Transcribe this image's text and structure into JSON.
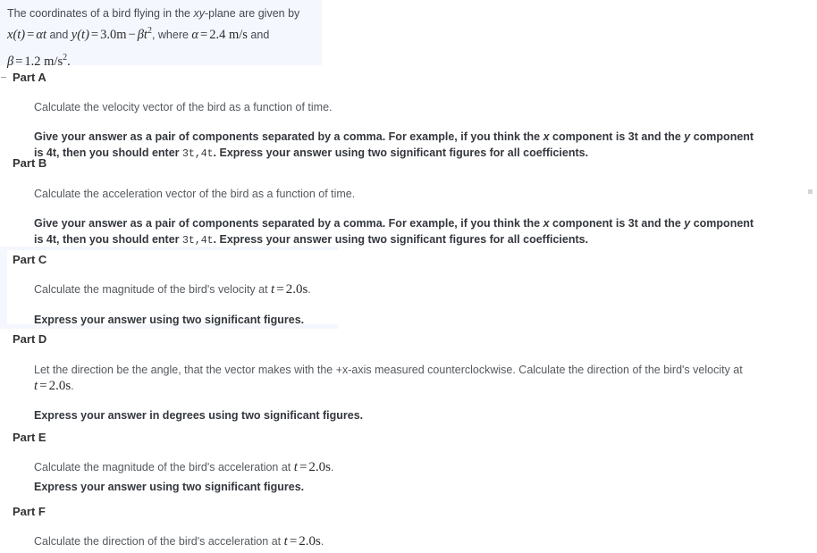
{
  "statement": {
    "line1_a": "The coordinates of a bird flying in the ",
    "line1_xy": "xy",
    "line1_b": "-plane are given by",
    "eq_x_var": "x",
    "eq_x_arg": "(t)",
    "eq_equals": "=",
    "eq_alpha": "α",
    "eq_alpha_t": "t",
    "and1": " and ",
    "eq_y_var": "y",
    "eq_y_arg": "(t)",
    "eq_y_rhs_1": "3.0m",
    "eq_minus": "−",
    "eq_beta": "β",
    "eq_beta_t": "t",
    "eq_beta_exp": "2",
    "where": ", where ",
    "alpha_sym": "α",
    "alpha_val": "2.4 m/s",
    "and2": " and",
    "beta_sym": "β",
    "beta_val": "1.2 m/s",
    "beta_exp": "2",
    "period": "."
  },
  "shared": {
    "give_answer_1a": "Give your answer as a pair of components separated by a comma. For example, if you think the ",
    "give_answer_x": "x",
    "give_answer_1b": " component is 3t and the ",
    "give_answer_y": "y",
    "give_answer_1c": " component",
    "give_answer_2a": "is 4t, then you should enter ",
    "give_answer_mono1": "3t",
    "give_answer_comma": ",",
    "give_answer_mono2": "4t",
    "give_answer_2b": ". Express your answer using two significant figures for all coefficients.",
    "express_two_sig": "Express your answer using two significant figures.",
    "express_degrees": "Express your answer in degrees using two significant figures.",
    "t_var": "t",
    "t_equals": "=",
    "t_value": "2.0s",
    "t_period": "."
  },
  "parts": [
    {
      "heading": "Part A",
      "question": "Calculate the velocity vector of the bird as a function of time."
    },
    {
      "heading": "Part B",
      "question": "Calculate the acceleration vector of the bird as a function of time."
    },
    {
      "heading": "Part C",
      "question_pre": "Calculate the magnitude of the bird's velocity at "
    },
    {
      "heading": "Part D",
      "question_pre": "Let the direction be the angle, that the vector makes with the +x-axis measured counterclockwise. Calculate the direction of the bird's velocity at"
    },
    {
      "heading": "Part E",
      "question_pre": "Calculate the magnitude of the bird's acceleration at "
    },
    {
      "heading": "Part F",
      "question_pre": "Calculate the direction of the bird's acceleration at "
    }
  ],
  "colors": {
    "highlight_background": "#f4f7fd",
    "page_background": "#ffffff",
    "heading_text": "#333333",
    "body_text": "#55595e",
    "bold_text": "#33373c"
  }
}
